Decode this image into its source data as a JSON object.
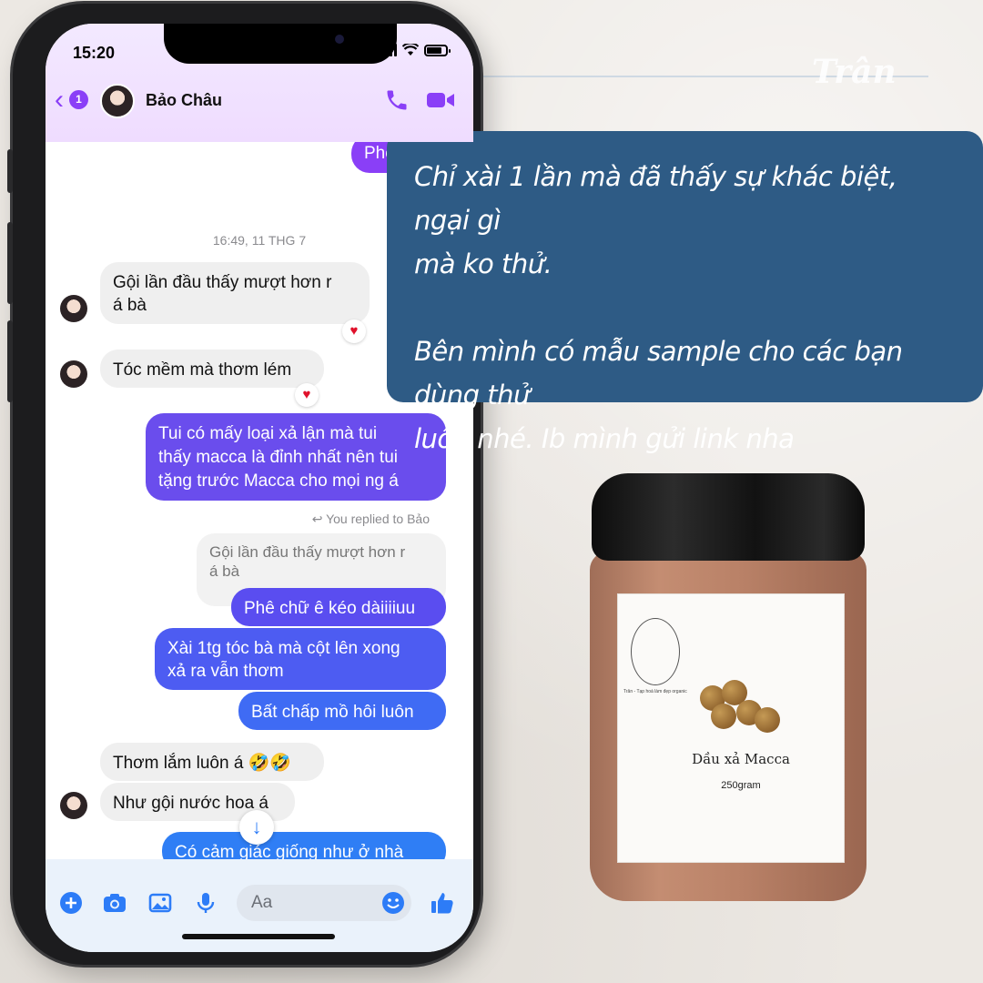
{
  "brand": {
    "name": "Trân"
  },
  "status": {
    "time": "15:20"
  },
  "header": {
    "unread_count": "1",
    "contact_name": "Bảo Châu"
  },
  "chat": {
    "partial_top": [
      "Phê",
      ""
    ],
    "timestamp": "16:49, 11 THG 7",
    "messages": {
      "in1": "Gội lần đầu thấy mượt hơn r\ná bà",
      "in2": "Tóc mềm mà thơm lém",
      "out1": "Tui có mấy loại xả lận mà tui\nthấy macca là đỉnh nhất nên tui\ntặng trước Macca cho mọi ng á",
      "replied_label": "You replied to Bảo",
      "quoted": "Gội lần đầu thấy mượt hơn r\ná bà",
      "out2": "Phê chữ ê kéo dàiiiiuu",
      "out3": "Xài 1tg tóc bà mà cột lên xong\nxả ra vẫn thơm",
      "out4": "Bất chấp mồ hôi luôn",
      "in3": "Thơm lắm luôn á 🤣🤣",
      "in4": "Như gội nước hoa á",
      "out5": "Có cảm giác giống như ở nhà"
    },
    "reaction": "♥"
  },
  "composer": {
    "placeholder": "Aa"
  },
  "quote": {
    "text": "Chỉ xài 1 lần mà đã thấy sự khác biệt, ngại gì\nmà ko thử.\n\nBên mình có mẫu sample cho các bạn dùng thử\nluôn nhé. Ib mình gửi link nha"
  },
  "product": {
    "brand_line": "Trân - Tạp hoá làm đẹp organic",
    "name": "Dầu xả Macca",
    "weight": "250gram"
  },
  "colors": {
    "accent": "#8a3ff7",
    "outgoing": "#5a4df0",
    "quote_bg": "#2e5b85"
  }
}
